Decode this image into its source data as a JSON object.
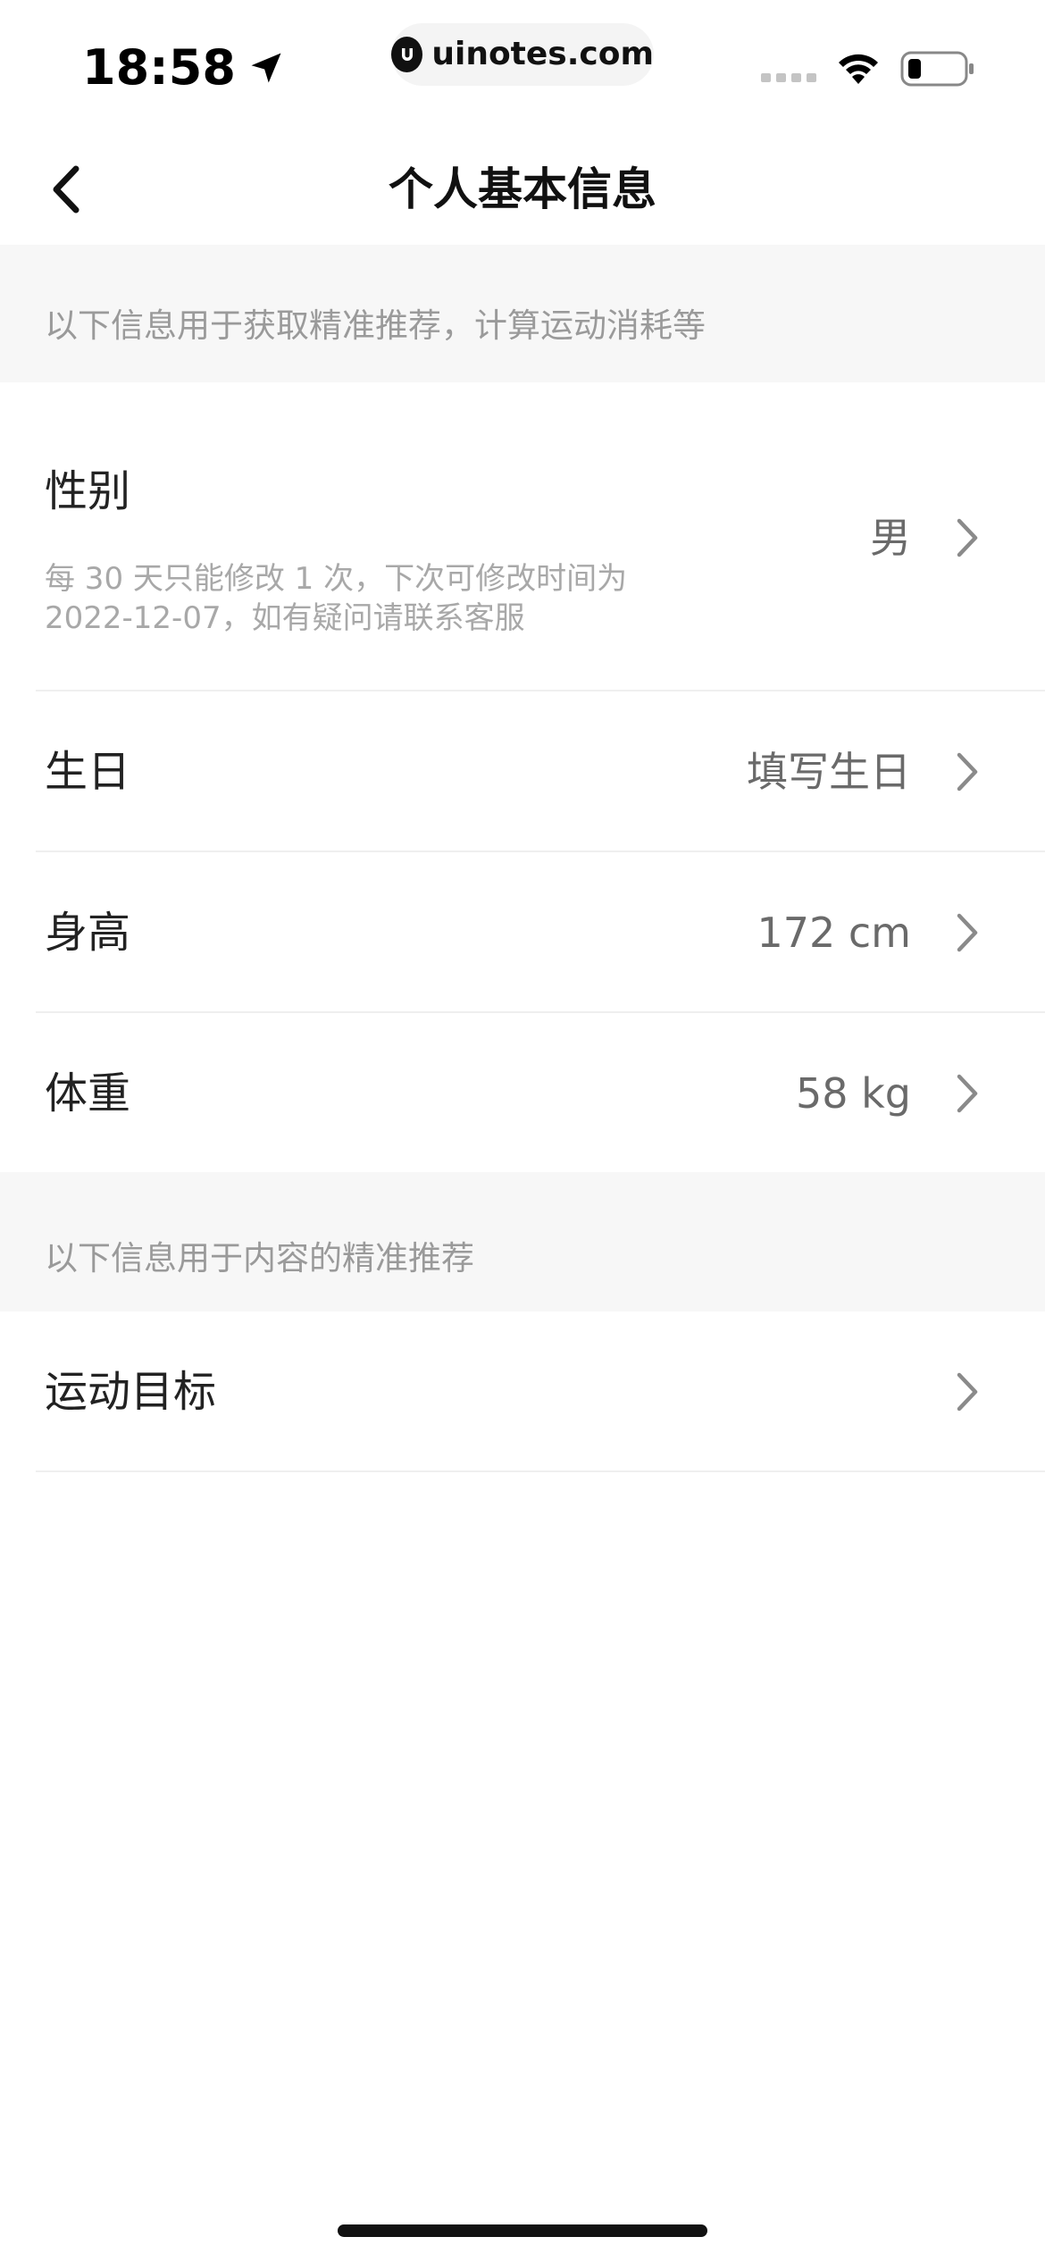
{
  "status_bar": {
    "time": "18:58",
    "url": "uinotes.com",
    "icons": {
      "location": "location-arrow-icon",
      "site_logo": "uinotes-logo-icon",
      "signal": "cellular-signal-icon",
      "wifi": "wifi-icon",
      "battery": "battery-icon"
    }
  },
  "nav": {
    "title": "个人基本信息",
    "back_icon": "chevron-left-icon"
  },
  "sections": [
    {
      "header": "以下信息用于获取精准推荐，计算运动消耗等",
      "rows": [
        {
          "label": "性别",
          "value": "男",
          "note": "每 30 天只能修改 1 次，下次可修改时间为 2022-12-07，如有疑问请联系客服"
        },
        {
          "label": "生日",
          "value": "填写生日"
        },
        {
          "label": "身高",
          "value": "172 cm"
        },
        {
          "label": "体重",
          "value": "58 kg"
        }
      ]
    },
    {
      "header": "以下信息用于内容的精准推荐",
      "rows": [
        {
          "label": "运动目标",
          "value": ""
        }
      ]
    }
  ],
  "colors": {
    "section_bg": "#f7f7f7",
    "section_text": "#9a9a9a",
    "label_text": "#222222",
    "value_text": "#6a6a6a",
    "chevron": "#8a8a8a",
    "divider": "#efefef"
  }
}
